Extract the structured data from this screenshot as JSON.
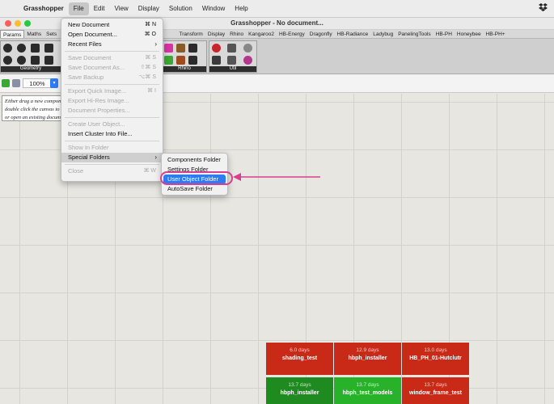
{
  "menubar": {
    "apple": "",
    "app_name": "Grasshopper",
    "items": [
      "File",
      "Edit",
      "View",
      "Display",
      "Solution",
      "Window",
      "Help"
    ],
    "dropbox_icon": "dropbox-icon"
  },
  "window": {
    "title": "Grasshopper - No document..."
  },
  "tabs": [
    "Params",
    "Maths",
    "Sets",
    "V",
    "Transform",
    "Display",
    "Rhino",
    "Kangaroo2",
    "HB-Energy",
    "Dragonfly",
    "HB-Radiance",
    "Ladybug",
    "PanelingTools",
    "HB-PH",
    "Honeybee",
    "HB-PH+"
  ],
  "ribbon": {
    "groups": [
      "Geometry",
      "Rhino",
      "Util"
    ]
  },
  "toolbar": {
    "zoom": "100%"
  },
  "canvas": {
    "hint_lines": [
      "Either drag a new component",
      "double click the canvas to",
      "or open an existing docum"
    ]
  },
  "file_menu": {
    "items": [
      {
        "label": "New Document",
        "shortcut": "⌘ N",
        "disabled": false
      },
      {
        "label": "Open Document...",
        "shortcut": "⌘ O",
        "disabled": false
      },
      {
        "label": "Recent Files",
        "shortcut": "",
        "submenu": true,
        "disabled": false
      },
      {
        "sep": true
      },
      {
        "label": "Save Document",
        "shortcut": "⌘ S",
        "disabled": true
      },
      {
        "label": "Save Document As...",
        "shortcut": "⇧⌘ S",
        "disabled": true
      },
      {
        "label": "Save Backup",
        "shortcut": "⌥⌘ S",
        "disabled": true
      },
      {
        "sep": true
      },
      {
        "label": "Export Quick Image...",
        "shortcut": "⌘ I",
        "disabled": true
      },
      {
        "label": "Export Hi-Res Image...",
        "shortcut": "",
        "disabled": true
      },
      {
        "label": "Document Properties...",
        "shortcut": "",
        "disabled": true
      },
      {
        "sep": true
      },
      {
        "label": "Create User Object...",
        "shortcut": "",
        "disabled": true
      },
      {
        "label": "Insert Cluster Into File...",
        "shortcut": "",
        "disabled": false
      },
      {
        "sep": true
      },
      {
        "label": "Show In Folder",
        "shortcut": "",
        "disabled": true
      },
      {
        "label": "Special Folders",
        "shortcut": "",
        "submenu": true,
        "disabled": false,
        "hover": true
      },
      {
        "sep": true
      },
      {
        "label": "Close",
        "shortcut": "⌘ W",
        "disabled": true
      }
    ]
  },
  "special_folders_menu": {
    "items": [
      "Components Folder",
      "Settings Folder",
      "User Object Folder",
      "AutoSave Folder"
    ],
    "selected": "User Object Folder"
  },
  "recent_tiles": [
    {
      "days": "6.0 days",
      "name": "shading_test",
      "color": "#c92a18"
    },
    {
      "days": "12.9 days",
      "name": "hbph_installer",
      "color": "#c92a18"
    },
    {
      "days": "13.0 days",
      "name": "HB_PH_01-Hutclutr",
      "color": "#c92a18"
    },
    {
      "days": "13.7 days",
      "name": "hbph_installer",
      "color": "#1f8a1f"
    },
    {
      "days": "13.7 days",
      "name": "hbph_test_models",
      "color": "#28b22a"
    },
    {
      "days": "13.7 days",
      "name": "window_frame_test",
      "color": "#c92a18"
    }
  ],
  "colors": {
    "accent": "#2e7bf6",
    "annotation": "#d6408f"
  }
}
